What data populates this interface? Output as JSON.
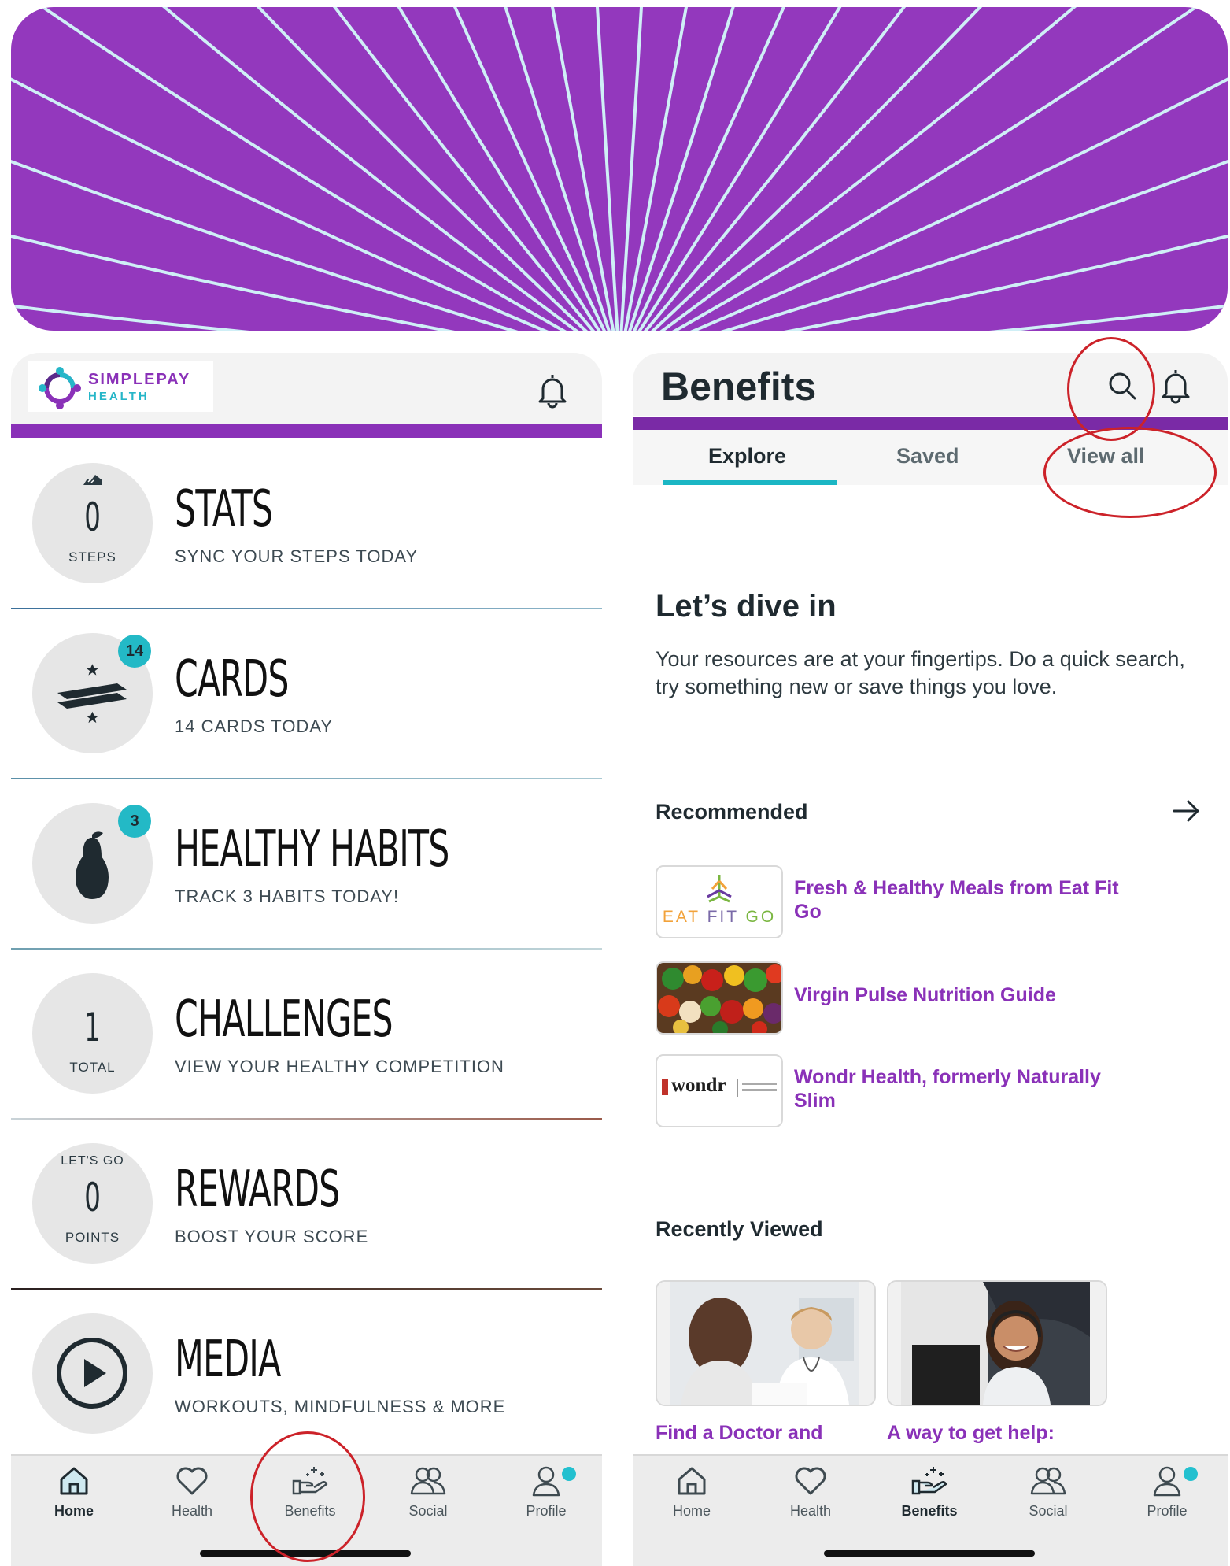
{
  "left_app": {
    "brand": {
      "name": "SIMPLEPAY",
      "sub": "HEALTH"
    },
    "rows": [
      {
        "circle_top": "",
        "circle_number": "0",
        "circle_sub": "STEPS",
        "badge": "",
        "title": "STATS",
        "subtitle": "SYNC YOUR STEPS TODAY",
        "icon": "shoe-icon"
      },
      {
        "circle_top": "",
        "circle_number": "",
        "circle_sub": "",
        "badge": "14",
        "title": "CARDS",
        "subtitle": "14 CARDS TODAY",
        "icon": "cards-icon"
      },
      {
        "circle_top": "",
        "circle_number": "",
        "circle_sub": "",
        "badge": "3",
        "title": "HEALTHY HABITS",
        "subtitle": "TRACK 3 HABITS TODAY!",
        "icon": "pear-icon"
      },
      {
        "circle_top": "",
        "circle_number": "1",
        "circle_sub": "TOTAL",
        "badge": "",
        "title": "CHALLENGES",
        "subtitle": "VIEW YOUR HEALTHY COMPETITION",
        "icon": ""
      },
      {
        "circle_top": "LET'S GO",
        "circle_number": "0",
        "circle_sub": "POINTS",
        "badge": "",
        "title": "REWARDS",
        "subtitle": "BOOST YOUR SCORE",
        "icon": ""
      },
      {
        "circle_top": "",
        "circle_number": "",
        "circle_sub": "",
        "badge": "",
        "title": "MEDIA",
        "subtitle": "WORKOUTS, MINDFULNESS & MORE",
        "icon": "play-icon"
      }
    ],
    "nav": [
      {
        "label": "Home",
        "icon": "home-icon",
        "active": true
      },
      {
        "label": "Health",
        "icon": "heart-icon",
        "active": false
      },
      {
        "label": "Benefits",
        "icon": "benefits-hand-icon",
        "active": false
      },
      {
        "label": "Social",
        "icon": "social-icon",
        "active": false
      },
      {
        "label": "Profile",
        "icon": "profile-icon",
        "active": false
      }
    ]
  },
  "right_app": {
    "title": "Benefits",
    "tabs": [
      {
        "label": "Explore",
        "active": true
      },
      {
        "label": "Saved",
        "active": false
      },
      {
        "label": "View all",
        "active": false
      }
    ],
    "intro": {
      "heading": "Let’s dive in",
      "body": "Your resources are at your fingertips. Do a quick search, try something new or save things you love."
    },
    "recommended": {
      "heading": "Recommended",
      "items": [
        {
          "label": "Fresh & Healthy Meals from Eat Fit Go",
          "thumb_text": "EAT FIT GO"
        },
        {
          "label": "Virgin Pulse Nutrition Guide",
          "thumb_text": ""
        },
        {
          "label": "Wondr Health, formerly Naturally Slim",
          "thumb_text": "wondr"
        }
      ]
    },
    "recently_viewed": {
      "heading": "Recently Viewed",
      "items": [
        {
          "label": "Find a Doctor and"
        },
        {
          "label": "A way to get help:"
        }
      ]
    },
    "nav": [
      {
        "label": "Home",
        "icon": "home-icon",
        "active": false
      },
      {
        "label": "Health",
        "icon": "heart-icon",
        "active": false
      },
      {
        "label": "Benefits",
        "icon": "benefits-hand-icon",
        "active": true
      },
      {
        "label": "Social",
        "icon": "social-icon",
        "active": false
      },
      {
        "label": "Profile",
        "icon": "profile-icon",
        "active": false
      }
    ]
  },
  "colors": {
    "brand_purple": "#8a31b8",
    "accent_teal": "#23b9c6",
    "annotation_red": "#cc2229"
  }
}
